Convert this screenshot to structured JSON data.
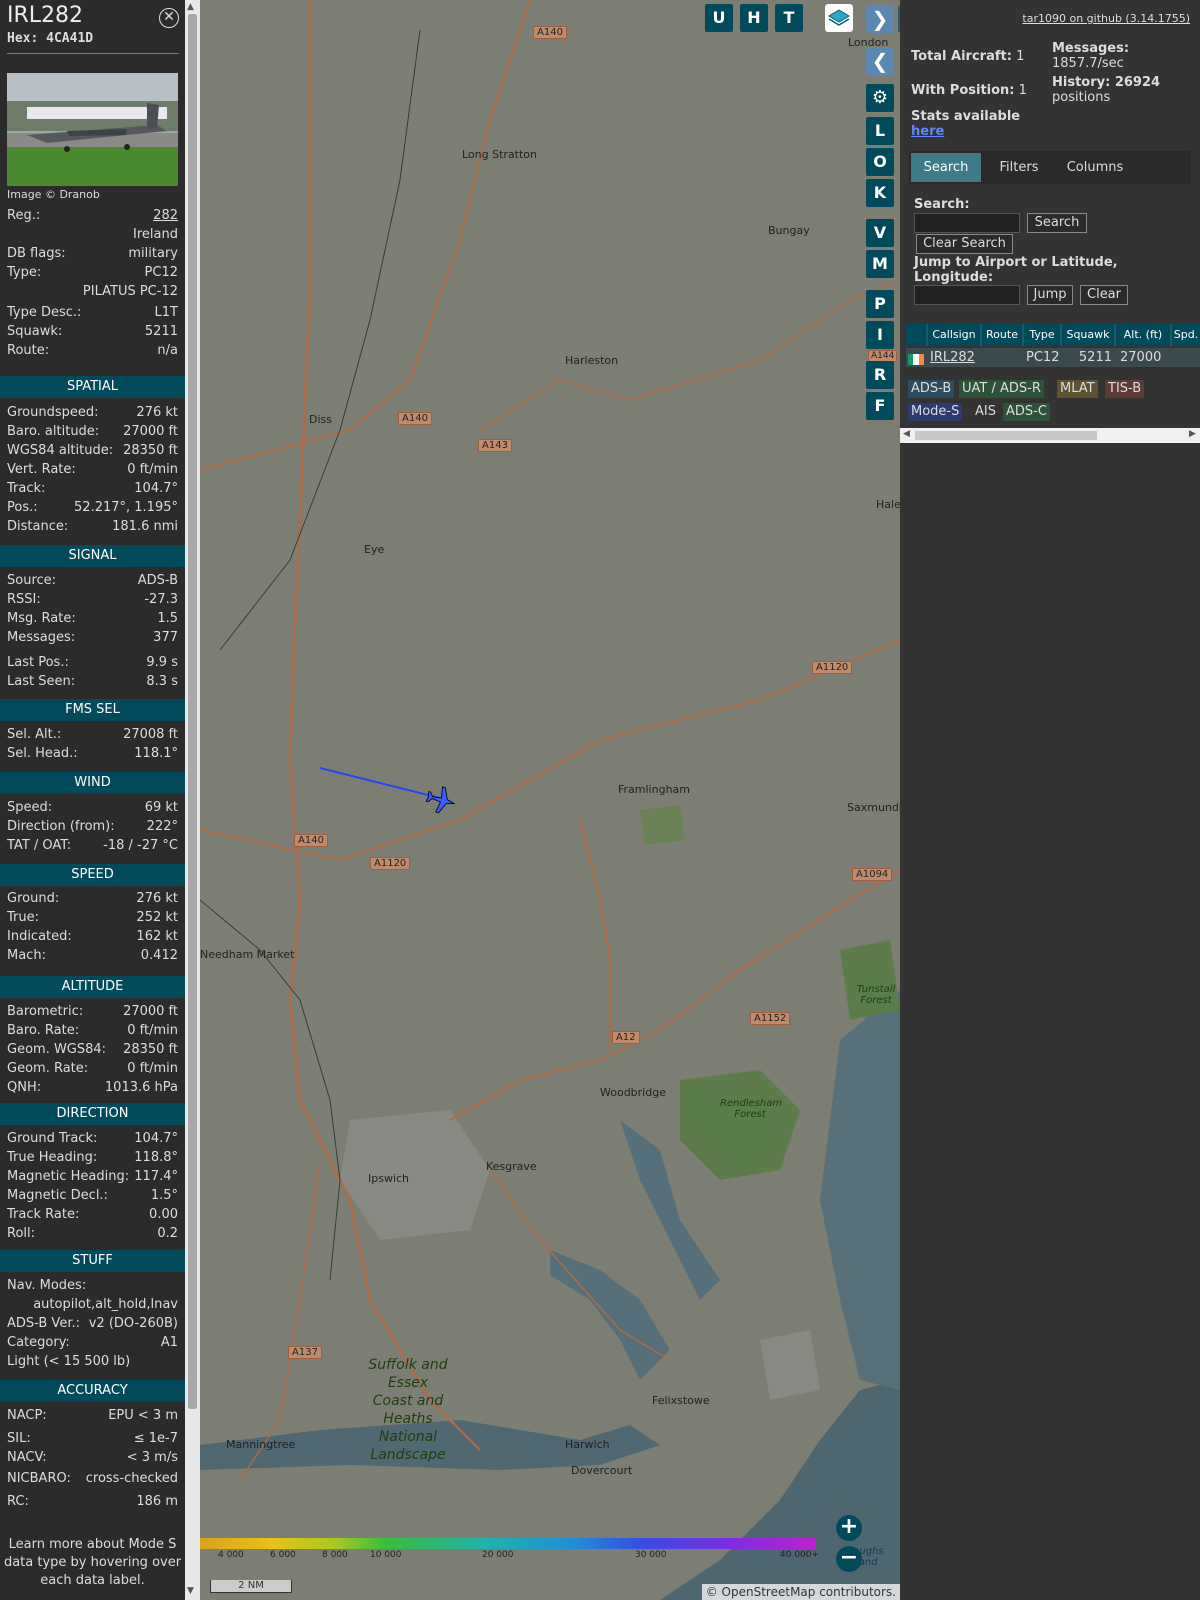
{
  "info": {
    "callsign": "IRL282",
    "hex_label": "Hex:",
    "hex": "4CA41D",
    "photo_credit": "Image © Dranob",
    "rows": [
      {
        "label": "Reg.:",
        "value": "282"
      },
      {
        "label": "",
        "value": "Ireland"
      },
      {
        "label": "DB flags:",
        "value": "military"
      },
      {
        "label": "Type:",
        "value": "PC12"
      },
      {
        "label": "",
        "value": "PILATUS PC-12"
      },
      {
        "label": "Type Desc.:",
        "value": "L1T"
      },
      {
        "label": "Squawk:",
        "value": "5211"
      },
      {
        "label": "Route:",
        "value": "n/a"
      }
    ],
    "sections": [
      {
        "title": "SPATIAL",
        "rows": [
          {
            "label": "Groundspeed:",
            "value": "276 kt"
          },
          {
            "label": "Baro. altitude:",
            "value": "27000 ft"
          },
          {
            "label": "WGS84 altitude:",
            "value": "28350 ft"
          },
          {
            "label": "Vert. Rate:",
            "value": "0 ft/min"
          },
          {
            "label": "Track:",
            "value": "104.7°"
          },
          {
            "label": "Pos.:",
            "value": "52.217°, 1.195°"
          },
          {
            "label": "Distance:",
            "value": "181.6 nmi"
          }
        ]
      },
      {
        "title": "SIGNAL",
        "rows": [
          {
            "label": "Source:",
            "value": "ADS-B"
          },
          {
            "label": "RSSI:",
            "value": "-27.3"
          },
          {
            "label": "Msg. Rate:",
            "value": "1.5"
          },
          {
            "label": "Messages:",
            "value": "377"
          },
          {
            "label": "Last Pos.:",
            "value": "9.9 s"
          },
          {
            "label": "Last Seen:",
            "value": "8.3 s"
          }
        ]
      },
      {
        "title": "FMS SEL",
        "rows": [
          {
            "label": "Sel. Alt.:",
            "value": "27008 ft"
          },
          {
            "label": "Sel. Head.:",
            "value": "118.1°"
          }
        ]
      },
      {
        "title": "WIND",
        "rows": [
          {
            "label": "Speed:",
            "value": "69 kt"
          },
          {
            "label": "Direction (from):",
            "value": "222°"
          },
          {
            "label": "TAT / OAT:",
            "value": "-18 / -27 °C"
          }
        ]
      },
      {
        "title": "SPEED",
        "rows": [
          {
            "label": "Ground:",
            "value": "276 kt"
          },
          {
            "label": "True:",
            "value": "252 kt"
          },
          {
            "label": "Indicated:",
            "value": "162 kt"
          },
          {
            "label": "Mach:",
            "value": "0.412"
          }
        ]
      },
      {
        "title": "ALTITUDE",
        "rows": [
          {
            "label": "Barometric:",
            "value": "27000 ft"
          },
          {
            "label": "Baro. Rate:",
            "value": "0 ft/min"
          },
          {
            "label": "Geom. WGS84:",
            "value": "28350 ft"
          },
          {
            "label": "Geom. Rate:",
            "value": "0 ft/min"
          },
          {
            "label": "QNH:",
            "value": "1013.6 hPa"
          }
        ]
      },
      {
        "title": "DIRECTION",
        "rows": [
          {
            "label": "Ground Track:",
            "value": "104.7°"
          },
          {
            "label": "True Heading:",
            "value": "118.8°"
          },
          {
            "label": "Magnetic Heading:",
            "value": "117.4°"
          },
          {
            "label": "Magnetic Decl.:",
            "value": "1.5°"
          },
          {
            "label": "Track Rate:",
            "value": "0.00"
          },
          {
            "label": "Roll:",
            "value": "0.2"
          }
        ]
      },
      {
        "title": "STUFF",
        "rows": [
          {
            "label": "Nav. Modes:",
            "value": ""
          },
          {
            "label": "",
            "value": "autopilot,alt_hold,lnav"
          },
          {
            "label": "ADS-B Ver.:",
            "value": "v2 (DO-260B)"
          },
          {
            "label": "Category:",
            "value": "A1"
          },
          {
            "label": "Light (< 15 500 lb)",
            "value": ""
          }
        ]
      },
      {
        "title": "ACCURACY",
        "rows": [
          {
            "label": "NACP:",
            "value": "EPU < 3 m"
          },
          {
            "label": "SIL:",
            "value": "≤ 1e-7"
          },
          {
            "label": "NACV:",
            "value": "< 3 m/s"
          },
          {
            "label": "NICBARO:",
            "value": "cross-checked"
          },
          {
            "label": "RC:",
            "value": "186 m"
          }
        ]
      }
    ],
    "learn_more": "Learn more about Mode S data type by hovering over each data label."
  },
  "map": {
    "places": [
      "Long Stratton",
      "Bungay",
      "Harleston",
      "Diss",
      "Eye",
      "Framlingham",
      "Saxmundh",
      "Halesw",
      "Needham Market",
      "Woodbridge",
      "Kesgrave",
      "Ipswich",
      "Felixstowe",
      "Harwich",
      "Dovercourt",
      "Manningtree",
      "London",
      "Rendlesham Forest",
      "Tunstall Forest",
      "Suffolk and Essex Coast and Heaths National Landscape",
      "Roughs Sand"
    ],
    "roads": [
      "A140",
      "A143",
      "A140",
      "A1120",
      "A1120",
      "A140",
      "A1094",
      "A1152",
      "A12",
      "A137",
      "A144"
    ],
    "right_buttons": [
      "U",
      "H",
      "T",
      "L",
      "O",
      "K",
      "V",
      "M",
      "P",
      "I",
      "R",
      "F"
    ],
    "altitude_scale": [
      "4 000",
      "6 000",
      "8 000",
      "10 000",
      "20 000",
      "30 000",
      "40 000+"
    ],
    "scale_label": "2 NM",
    "attribution": "© OpenStreetMap contributors."
  },
  "right": {
    "github": "tar1090 on github (3.14.1755)",
    "total_label": "Total Aircraft:",
    "total": "1",
    "with_pos_label": "With Position:",
    "with_pos": "1",
    "messages_label": "Messages:",
    "messages_rate": "1857.7/sec",
    "history_label": "History: 26924",
    "history_unit": "positions",
    "stats_label": "Stats available",
    "stats_link": "here",
    "tabs": [
      "Search",
      "Filters",
      "Columns"
    ],
    "search_label": "Search:",
    "search_btn": "Search",
    "clear_search_btn": "Clear Search",
    "jump_label": "Jump to Airport or Latitude, Longitude:",
    "jump_btn": "Jump",
    "clear_btn": "Clear",
    "columns": [
      "Callsign",
      "Route",
      "Type",
      "Squawk",
      "Alt. (ft)",
      "Spd."
    ],
    "row": {
      "callsign": "IRL282",
      "route": "",
      "type": "PC12",
      "squawk": "5211",
      "alt": "27000"
    },
    "sources": [
      "ADS-B",
      "UAT / ADS-R",
      "MLAT",
      "TIS-B",
      "Mode-S",
      "AIS",
      "ADS-C"
    ]
  }
}
